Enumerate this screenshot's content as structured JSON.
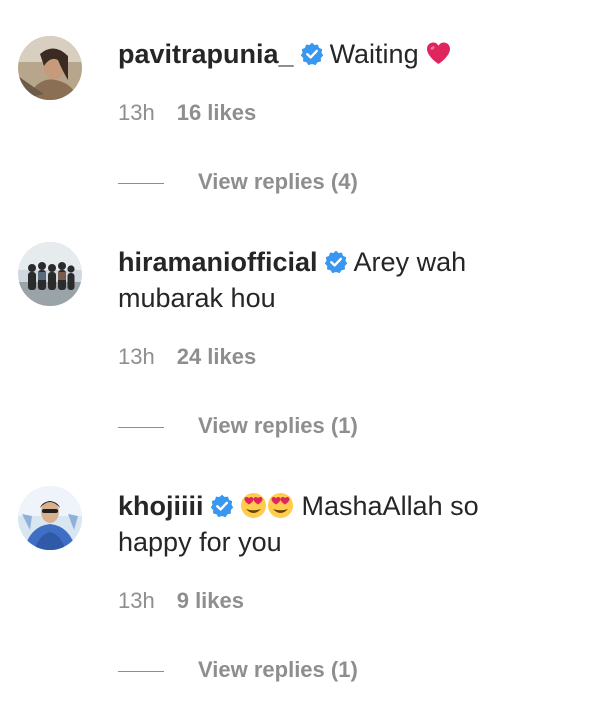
{
  "comments": [
    {
      "username": "pavitrapunia_",
      "verified": true,
      "text": "Waiting",
      "emoji_after": "heart-emoji",
      "time": "13h",
      "likes": "16 likes",
      "replies": "View replies (4)"
    },
    {
      "username": "hiramaniofficial",
      "verified": true,
      "text": "Arey wah",
      "text_line2": "mubarak hou",
      "time": "13h",
      "likes": "24 likes",
      "replies": "View replies (1)"
    },
    {
      "username": "khojiiii",
      "verified": true,
      "emoji_before": [
        "heart-eyes-emoji",
        "heart-eyes-emoji"
      ],
      "text": "MashaAllah so",
      "text_line2": "happy for you",
      "time": "13h",
      "likes": "9 likes",
      "replies": "View replies (1)"
    }
  ],
  "colors": {
    "text": "#262626",
    "muted": "#8e8e8e",
    "verified": "#3897f0",
    "heart": "#e0245e"
  }
}
